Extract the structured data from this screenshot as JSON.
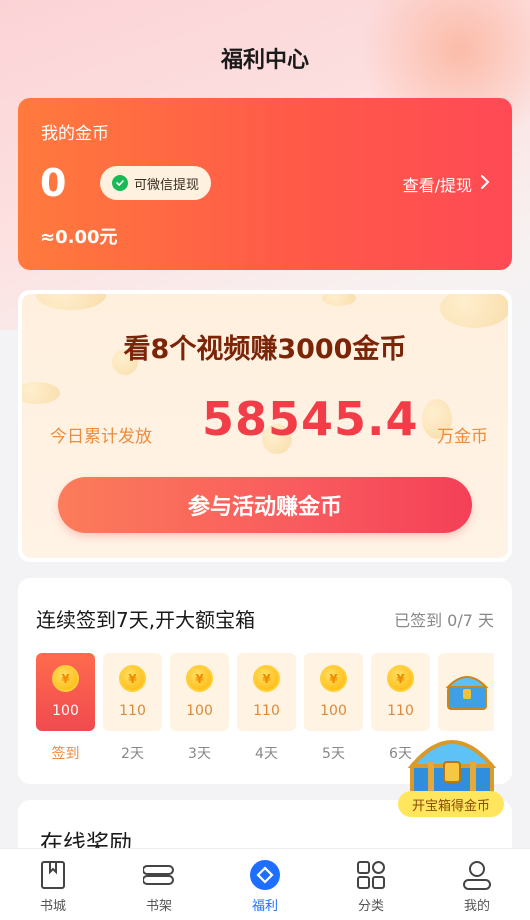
{
  "header": {
    "title": "福利中心"
  },
  "coin_card": {
    "title": "我的金币",
    "amount": "0",
    "wechat_label": "可微信提现",
    "view_label": "查看/提现",
    "rmb": "≈0.00元"
  },
  "promo": {
    "title": "看8个视频赚3000金币",
    "left_label": "今日累计发放",
    "number": "58545.4",
    "right_label": "万金币",
    "button": "参与活动赚金币"
  },
  "sign_in": {
    "title": "连续签到7天,开大额宝箱",
    "status": "已签到 0/7 天",
    "coin_symbol": "¥",
    "days": [
      {
        "value": "100",
        "label": "签到",
        "active": true
      },
      {
        "value": "110",
        "label": "2天"
      },
      {
        "value": "100",
        "label": "3天"
      },
      {
        "value": "110",
        "label": "4天"
      },
      {
        "value": "100",
        "label": "5天"
      },
      {
        "value": "110",
        "label": "6天"
      }
    ],
    "chest_caption": "开宝箱得金币"
  },
  "online": {
    "title": "在线奖励"
  },
  "tabbar": {
    "items": [
      {
        "label": "书城",
        "icon": "book-icon"
      },
      {
        "label": "书架",
        "icon": "bookshelf-icon"
      },
      {
        "label": "福利",
        "icon": "welfare-icon",
        "active": true
      },
      {
        "label": "分类",
        "icon": "category-icon"
      },
      {
        "label": "我的",
        "icon": "profile-icon"
      }
    ]
  },
  "colors": {
    "accent_blue": "#1e6fff",
    "coin_card_orange": "#ff6a40",
    "promo_red": "#f23d49"
  }
}
